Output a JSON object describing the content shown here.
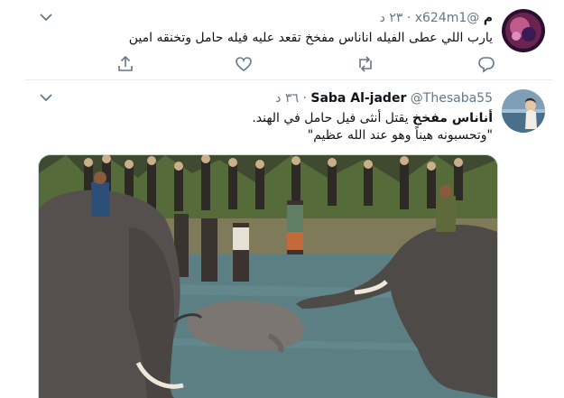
{
  "tweet1": {
    "display_name": "م",
    "handle": "@x624m1",
    "time": "٢٣ د",
    "sep": "·",
    "text": "يارب اللي عطى الفيله اناناس مفخخ تقعد عليه فيله حامل وتخنقه امين"
  },
  "tweet2": {
    "display_name": "Saba Al-jader",
    "handle": "@Thesaba55",
    "time": "٣٦ د",
    "sep": "·",
    "line1_bold": "أناناس مفخخ",
    "line1_rest": " يقتل أنثى فيل حامل في الهند.",
    "line2": "\"وتحسبونه هيناً وهو عند الله عظيم\""
  },
  "icons": [
    "chevron-down-icon",
    "reply-icon",
    "retweet-icon",
    "like-icon",
    "share-icon"
  ],
  "colors": {
    "text": "#0f1419",
    "muted": "#657786",
    "border": "#e6ecf0"
  }
}
